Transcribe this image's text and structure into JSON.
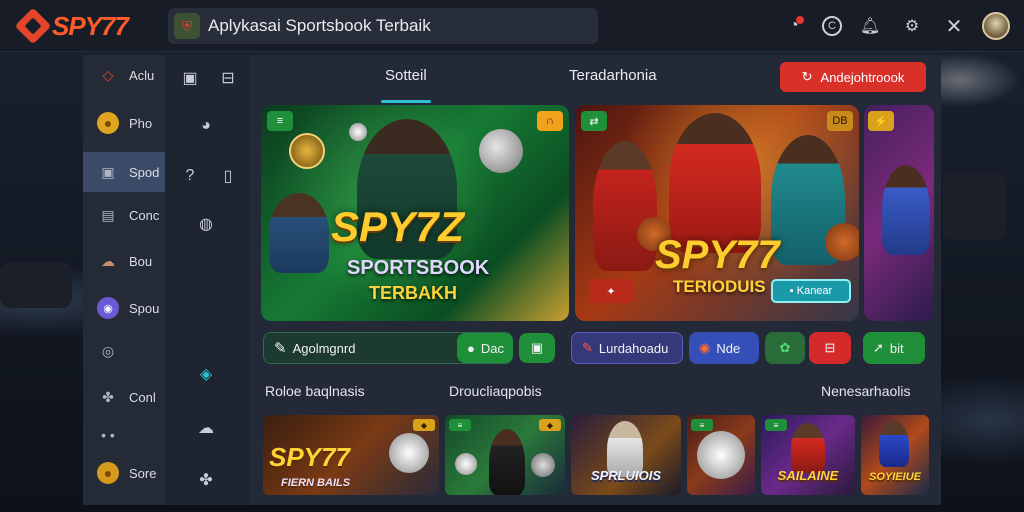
{
  "app": {
    "logo_text": "SPY77",
    "title": "Aplykasai Sportsbook Terbaik"
  },
  "top_icons": [
    "notification-icon",
    "copyright-icon",
    "bell-icon",
    "settings-icon",
    "close-icon",
    "profile-avatar"
  ],
  "left_menu": {
    "items": [
      {
        "label": "Aclu",
        "icon": "diamond-icon",
        "active": false
      },
      {
        "label": "Pho",
        "icon": "coin-icon",
        "active": false
      },
      {
        "label": "Spod",
        "icon": "square-icon",
        "active": true
      },
      {
        "label": "Conc",
        "icon": "card-icon",
        "active": false
      },
      {
        "label": "Bou",
        "icon": "cloud-icon",
        "active": false
      },
      {
        "label": "Spou",
        "icon": "discord-icon",
        "active": false
      },
      {
        "label": "",
        "icon": "instagram-icon",
        "active": false
      },
      {
        "label": "Conl",
        "icon": "puzzle-icon",
        "active": false
      },
      {
        "label": "",
        "icon": "more-icon",
        "active": false
      },
      {
        "label": "Sore",
        "icon": "coin-icon",
        "active": false
      }
    ]
  },
  "tabs": [
    {
      "label": "Sotteil",
      "active": true
    },
    {
      "label": "Teradarhonia",
      "active": false
    }
  ],
  "cta_label": "Andejohtroook",
  "banners": {
    "card1": {
      "title": "SPY7Z",
      "subtitle": "SPORTSBOOK",
      "tagline": "TERBAKH"
    },
    "card2": {
      "title": "SPY77",
      "tagline": "TERIODUIS",
      "button": "Kanear",
      "badge": "DB"
    }
  },
  "action_row": {
    "search_label": "Agolmgnrd",
    "buttons": [
      {
        "label": "Dac",
        "color": "#1f8f3a"
      },
      {
        "label": "",
        "color": "#1f8f3a"
      },
      {
        "label": "Lurdahoadu",
        "color": "#3b3f8f"
      },
      {
        "label": "Nde",
        "color": "#3450b8"
      },
      {
        "label": "",
        "color": "#2a6b3a"
      },
      {
        "label": "",
        "color": "#d42a2a"
      },
      {
        "label": "bit",
        "color": "#1f8f3a"
      }
    ]
  },
  "sections": [
    "Roloe baqlnasis",
    "Droucliaqpobis",
    "Nenesarhaolis"
  ],
  "thumbnails": [
    {
      "label": "SPY77",
      "sub": "FIERN BAILS"
    },
    {
      "label": "",
      "sub": ""
    },
    {
      "label": "SPRLUIOIS",
      "sub": ""
    },
    {
      "label": "",
      "sub": ""
    },
    {
      "label": "SAILAINE",
      "sub": ""
    },
    {
      "label": "SOYIEIUE",
      "sub": ""
    }
  ]
}
